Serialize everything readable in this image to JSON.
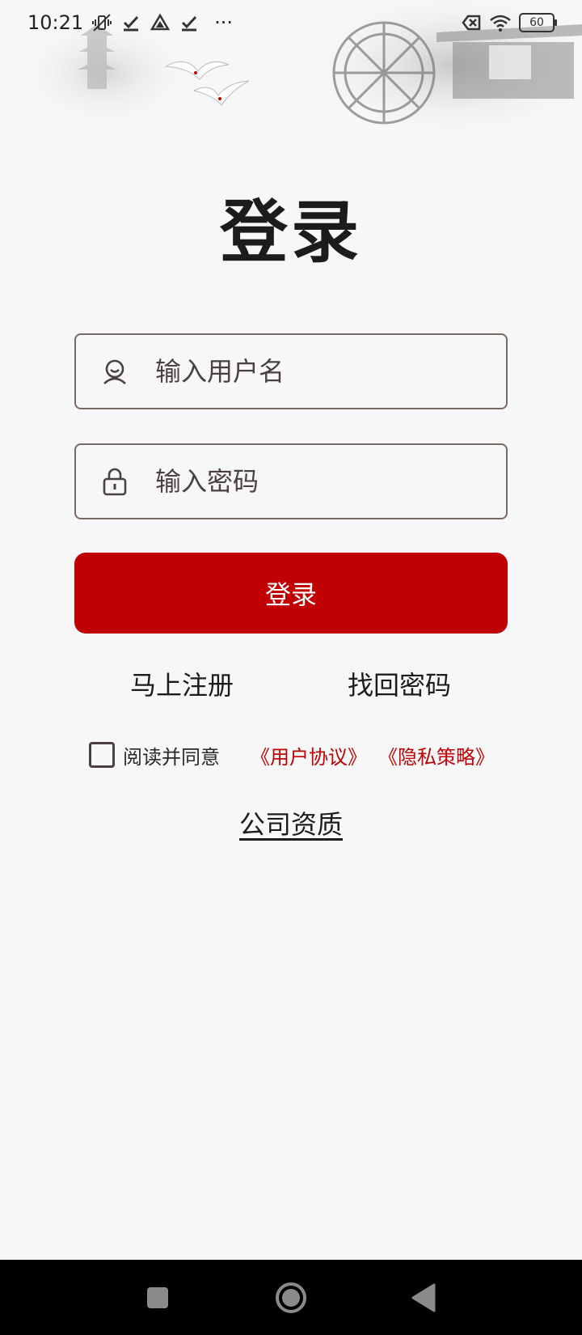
{
  "status_bar": {
    "time": "10:21",
    "left_icons": [
      "vibrate-off-icon",
      "check-icon",
      "drive-icon",
      "check-icon"
    ],
    "more": "···",
    "battery": "60"
  },
  "page": {
    "title": "登录"
  },
  "form": {
    "username_placeholder": "输入用户名",
    "password_placeholder": "输入密码",
    "login_button": "登录"
  },
  "links": {
    "register": "马上注册",
    "recover_password": "找回密码"
  },
  "agreement": {
    "prefix": "阅读并同意",
    "user_agreement": "《用户协议》",
    "privacy_policy": "《隐私策略》"
  },
  "company_qualification": "公司资质",
  "colors": {
    "accent": "#c00003",
    "background": "#f7f7f7",
    "text": "#1c1c1c"
  }
}
